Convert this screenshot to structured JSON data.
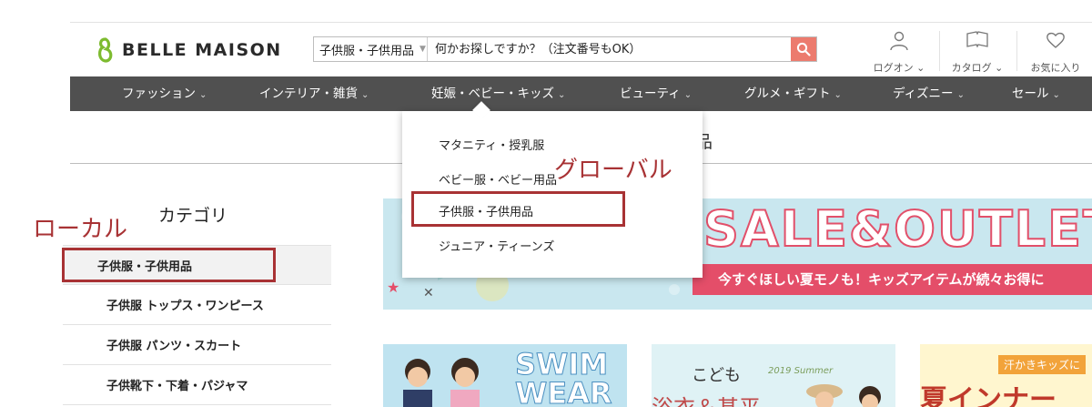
{
  "header": {
    "logo_text": "BELLE MAISON",
    "search_category": "子供服・子供用品",
    "search_placeholder": "何かお探しですか？（注文番号もOK）",
    "util": [
      {
        "label": "ログオン ⌄",
        "icon": "user-icon"
      },
      {
        "label": "カタログ ⌄",
        "icon": "book-icon"
      },
      {
        "label": "お気に入り",
        "icon": "heart-icon"
      }
    ]
  },
  "nav": {
    "items": [
      {
        "label": "ファッション"
      },
      {
        "label": "インテリア・雑貨"
      },
      {
        "label": "妊娠・ベビー・キッズ"
      },
      {
        "label": "ビューティ"
      },
      {
        "label": "グルメ・ギフト"
      },
      {
        "label": "ディズニー"
      },
      {
        "label": "セール"
      }
    ],
    "chevron": "⌄"
  },
  "peek_text": "品",
  "dropdown": {
    "items": [
      {
        "label": "マタニティ・授乳服"
      },
      {
        "label": "ベビー服・ベビー用品"
      },
      {
        "label": "子供服・子供用品"
      },
      {
        "label": "ジュニア・ティーンズ"
      }
    ]
  },
  "sidebar": {
    "title": "カテゴリ",
    "items": [
      {
        "label": "子供服・子供用品"
      },
      {
        "label": "子供服 トップス・ワンピース"
      },
      {
        "label": "子供服 パンツ・スカート"
      },
      {
        "label": "子供靴下・下着・パジャマ"
      }
    ]
  },
  "banner": {
    "title": "SALE&OUTLET",
    "subtitle": "今すぐほしい夏モノも！キッズアイテムが続々お得に",
    "accent": "#e44e69"
  },
  "cards": [
    {
      "text": "SWIM WEAR"
    },
    {
      "text": "こども",
      "text2": "浴衣＆甚平",
      "tag": "2019 Summer"
    },
    {
      "text": "汗かきキッズに",
      "text2": "夏インナー"
    }
  ],
  "annotations": {
    "global_label": "グローバル",
    "local_label": "ローカル",
    "color": "#a83234"
  }
}
